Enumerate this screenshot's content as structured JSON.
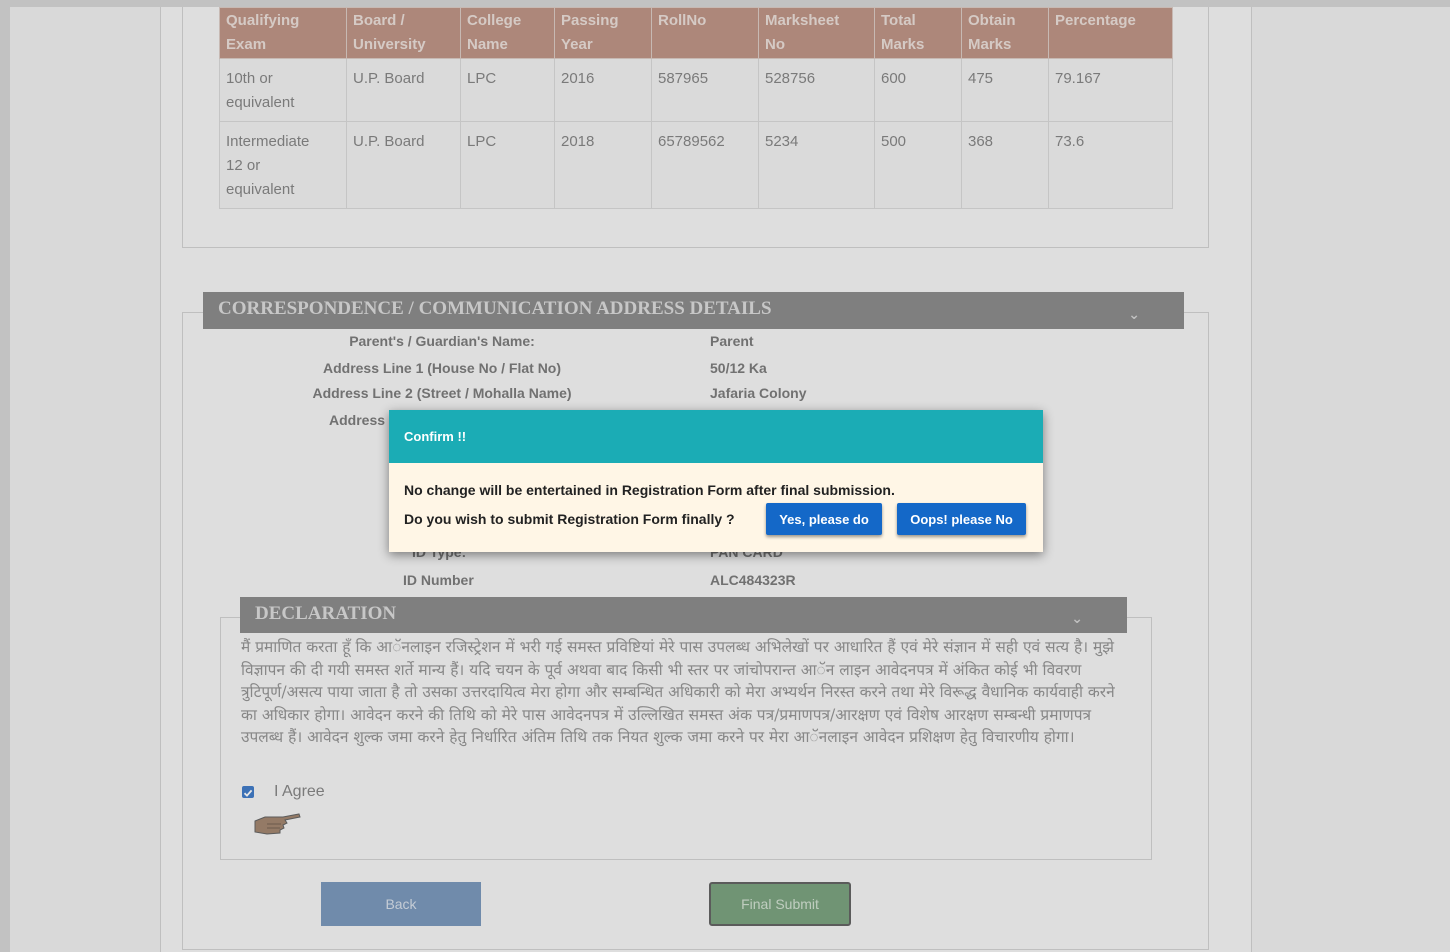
{
  "qualification_table": {
    "headers": [
      [
        "Qualifying",
        "Exam"
      ],
      [
        "Board /",
        "University"
      ],
      [
        "College",
        "Name"
      ],
      [
        "Passing",
        "Year"
      ],
      [
        "RollNo",
        ""
      ],
      [
        "Marksheet",
        "No"
      ],
      [
        "Total",
        "Marks"
      ],
      [
        "Obtain",
        "Marks"
      ],
      [
        "Percentage",
        ""
      ]
    ],
    "rows": [
      {
        "exam": [
          "10th or",
          "equivalent"
        ],
        "board": "U.P. Board",
        "college": "LPC",
        "year": "2016",
        "roll": "587965",
        "marksheet": "528756",
        "total": "600",
        "obtain": "475",
        "percentage": "79.167"
      },
      {
        "exam": [
          "Intermediate",
          "12 or",
          "equivalent"
        ],
        "board": "U.P. Board",
        "college": "LPC",
        "year": "2018",
        "roll": "65789562",
        "marksheet": "5234",
        "total": "500",
        "obtain": "368",
        "percentage": "73.6"
      }
    ]
  },
  "correspondence": {
    "title": "CORRESPONDENCE / COMMUNICATION ADDRESS DETAILS",
    "fields": [
      {
        "label": "Parent's / Guardian's Name:",
        "value": "Parent"
      },
      {
        "label": "Address Line 1 (House No / Flat No)",
        "value": "50/12 Ka"
      },
      {
        "label": "Address Line 2 (Street / Mohalla Name)",
        "value": "Jafaria Colony"
      }
    ],
    "partial_label": "Address",
    "id_type_label": "ID Type:",
    "id_type_value": "PAN CARD",
    "id_number_label": "ID Number",
    "id_number_value": "ALC484323R"
  },
  "declaration": {
    "title": "DECLARATION",
    "text": "मैं प्रमाणित करता हूँ कि आॅनलाइन रजिस्ट्रेशन में भरी गई समस्त प्रविष्टियां मेरे पास उपलब्ध अभिलेखों पर आधारित हैं एवं मेरे संज्ञान में सही एवं सत्य है। मुझे विज्ञापन की दी गयी समस्त शर्ते मान्य हैं। यदि चयन के पूर्व अथवा बाद किसी भी स्तर पर जांचोपरान्त आॅन लाइन आवेदनपत्र में अंकित कोई भी विवरण त्रुटिपूर्ण/असत्य पाया जाता है तो उसका उत्तरदायित्व मेरा होगा और सम्बन्धित अधिकारी को मेरा अभ्यर्थन निरस्त करने तथा मेरे विरूद्ध वैधानिक कार्यवाही करने का अधिकार होगा। आवेदन करने की तिथि को मेरे पास आवेदनपत्र में उल्लिखित समस्त अंक पत्र/प्रमाणपत्र/आरक्षण एवं विशेष आरक्षण सम्बन्धी प्रमाणपत्र उपलब्ध हैं। आवेदन शुल्क जमा करने हेतु निर्धारित अंतिम तिथि तक नियत शुल्क जमा करने पर मेरा आॅनलाइन आवेदन प्रशिक्षण हेतु विचारणीय होगा।",
    "agree_label": "I Agree"
  },
  "buttons": {
    "back": "Back",
    "final_submit": "Final Submit"
  },
  "modal": {
    "title": "Confirm !!",
    "line1": "No change will be entertained in Registration Form after final submission.",
    "line2": "Do you wish to submit Registration Form finally ?",
    "yes": "Yes, please do",
    "no": "Oops! please No"
  },
  "colors": {
    "modal_header": "#1bacb5",
    "modal_button": "#1468c8",
    "table_header": "#b98a7a",
    "section_header": "#808080"
  }
}
